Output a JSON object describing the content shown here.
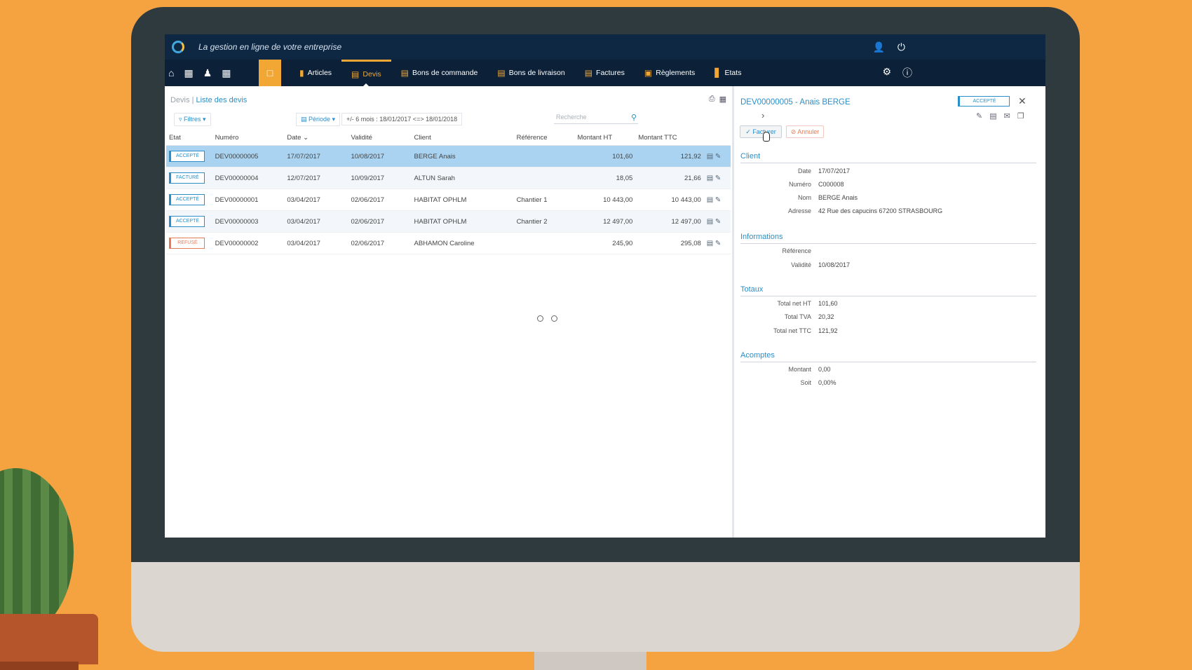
{
  "app": {
    "tagline": "La gestion en ligne de votre entreprise"
  },
  "nav": {
    "tabs": [
      {
        "label": "Articles"
      },
      {
        "label": "Devis"
      },
      {
        "label": "Bons de commande"
      },
      {
        "label": "Bons de livraison"
      },
      {
        "label": "Factures"
      },
      {
        "label": "Règlements"
      },
      {
        "label": "Etats"
      }
    ],
    "active_tab": "Devis"
  },
  "list": {
    "breadcrumb_root": "Devis",
    "breadcrumb_current": "Liste des devis",
    "filters_label": "Filtres",
    "period_label": "Période",
    "range_text": "+/- 6 mois : 18/01/2017 <=> 18/01/2018",
    "search_placeholder": "Recherche",
    "columns": [
      "Etat",
      "Numéro",
      "Date",
      "Validité",
      "Client",
      "Référence",
      "Montant HT",
      "Montant TTC"
    ],
    "rows": [
      {
        "etat": "ACCEPTÉ",
        "numero": "DEV00000005",
        "date": "17/07/2017",
        "validite": "10/08/2017",
        "client": "BERGE Anais",
        "reference": "",
        "ht": "101,60",
        "ttc": "121,92"
      },
      {
        "etat": "FACTURÉ",
        "numero": "DEV00000004",
        "date": "12/07/2017",
        "validite": "10/09/2017",
        "client": "ALTUN Sarah",
        "reference": "",
        "ht": "18,05",
        "ttc": "21,66"
      },
      {
        "etat": "ACCEPTÉ",
        "numero": "DEV00000001",
        "date": "03/04/2017",
        "validite": "02/06/2017",
        "client": "HABITAT OPHLM",
        "reference": "Chantier 1",
        "ht": "10 443,00",
        "ttc": "10 443,00"
      },
      {
        "etat": "ACCEPTÉ",
        "numero": "DEV00000003",
        "date": "03/04/2017",
        "validite": "02/06/2017",
        "client": "HABITAT OPHLM",
        "reference": "Chantier 2",
        "ht": "12 497,00",
        "ttc": "12 497,00"
      },
      {
        "etat": "REFUSÉ",
        "numero": "DEV00000002",
        "date": "03/04/2017",
        "validite": "02/06/2017",
        "client": "ABHAMON Caroline",
        "reference": "",
        "ht": "245,90",
        "ttc": "295,08"
      }
    ]
  },
  "detail": {
    "title": "DEV00000005 - Anais BERGE",
    "status": "ACCEPTÉ",
    "btn_facturer": "Facturer",
    "btn_annuler": "Annuler",
    "client_heading": "Client",
    "client": [
      {
        "k": "Date",
        "v": "17/07/2017"
      },
      {
        "k": "Numéro",
        "v": "C000008"
      },
      {
        "k": "Nom",
        "v": "BERGE Anais"
      },
      {
        "k": "Adresse",
        "v": "42 Rue des capucins 67200 STRASBOURG"
      }
    ],
    "info_heading": "Informations",
    "info": [
      {
        "k": "Référence",
        "v": ""
      },
      {
        "k": "Validité",
        "v": "10/08/2017"
      }
    ],
    "totaux_heading": "Totaux",
    "totaux": [
      {
        "k": "Total net HT",
        "v": "101,60"
      },
      {
        "k": "Total TVA",
        "v": "20,32"
      },
      {
        "k": "Total net TTC",
        "v": "121,92"
      }
    ],
    "acomptes_heading": "Acomptes",
    "acomptes": [
      {
        "k": "Montant",
        "v": "0,00"
      },
      {
        "k": "Soit",
        "v": "0,00%"
      }
    ]
  },
  "colors": {
    "brand_navy": "#0e2843",
    "accent_orange": "#f2a633",
    "link_blue": "#2a8fc9",
    "selected_row": "#a9d3f1",
    "refused": "#e57b55"
  }
}
